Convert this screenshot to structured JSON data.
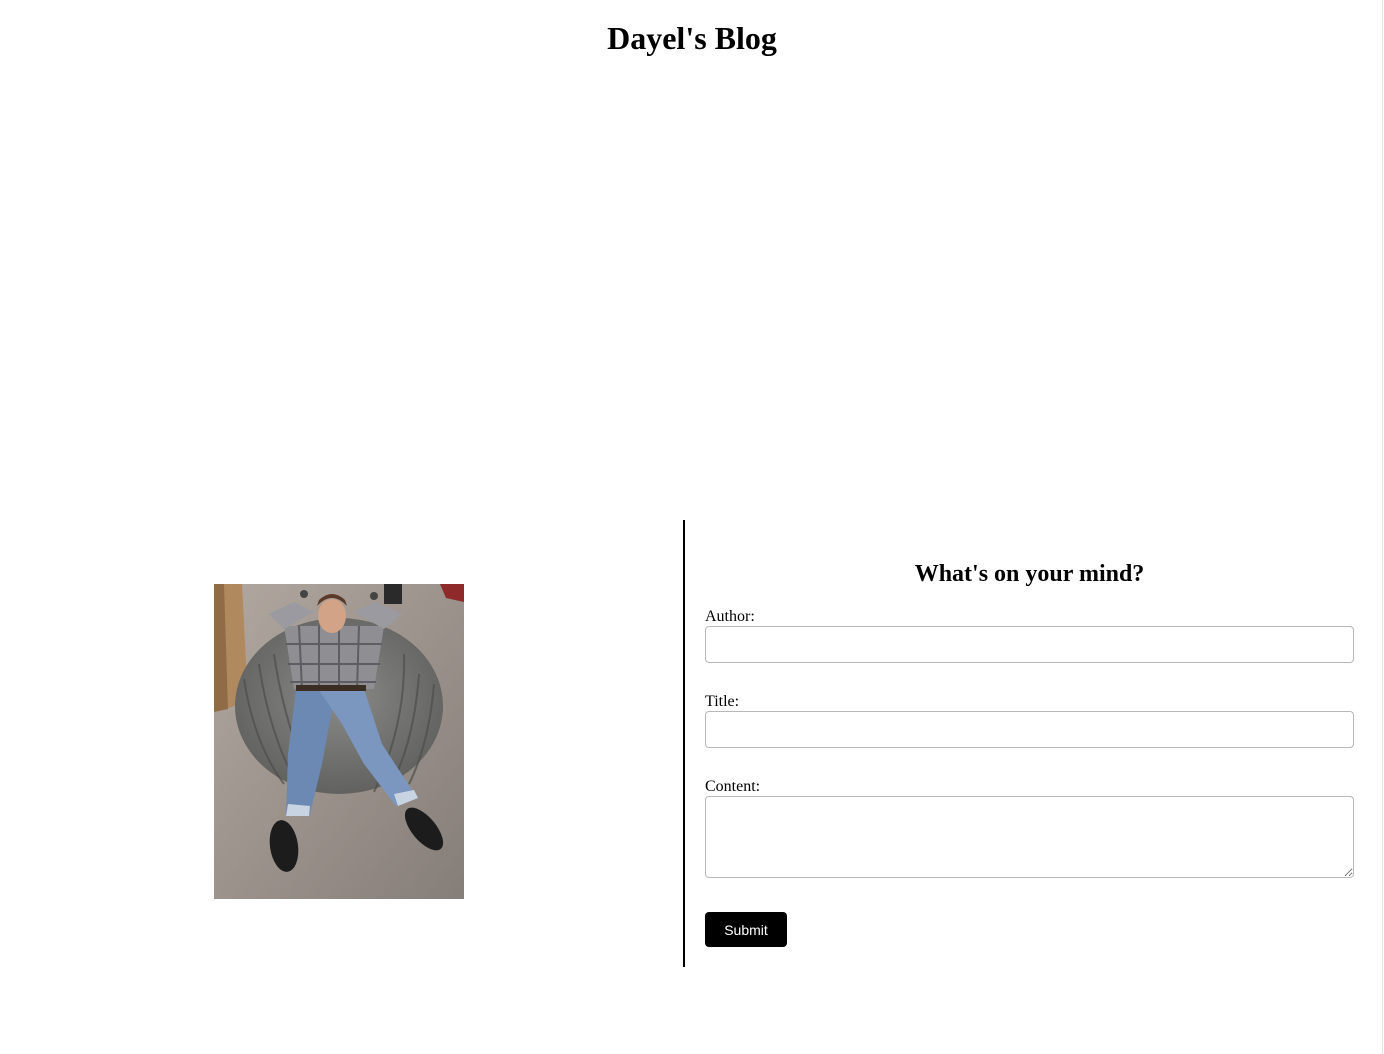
{
  "header": {
    "title": "Dayel's Blog"
  },
  "photo": {
    "alt": "Person lounging on a large gray corduroy bean bag chair in a store"
  },
  "form": {
    "heading": "What's on your mind?",
    "author_label": "Author:",
    "author_value": "",
    "title_label": "Title:",
    "title_value": "",
    "content_label": "Content:",
    "content_value": "",
    "submit_label": "Submit"
  },
  "colors": {
    "button_bg": "#000000",
    "button_text": "#ffffff",
    "divider": "#000000",
    "input_border": "#b8b8b8"
  }
}
